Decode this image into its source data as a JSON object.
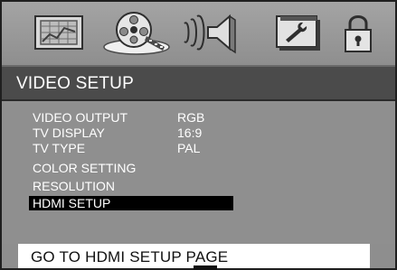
{
  "toolbar": {
    "icons": [
      {
        "name": "general-setup-icon"
      },
      {
        "name": "video-setup-icon",
        "selected": true
      },
      {
        "name": "audio-setup-icon"
      },
      {
        "name": "preferences-setup-icon"
      },
      {
        "name": "password-lock-icon"
      }
    ]
  },
  "header": {
    "title": "VIDEO SETUP"
  },
  "menu": {
    "items": [
      {
        "label": "VIDEO OUTPUT",
        "value": "RGB"
      },
      {
        "label": "TV DISPLAY",
        "value": "16:9"
      },
      {
        "label": "TV TYPE",
        "value": "PAL"
      },
      {
        "label": "COLOR SETTING",
        "value": ""
      },
      {
        "label": "RESOLUTION",
        "value": ""
      },
      {
        "label": "HDMI SETUP",
        "value": "",
        "selected": true
      }
    ]
  },
  "footer": {
    "hint": "GO TO HDMI SETUP PAGE"
  },
  "colors": {
    "panel": "#8e8e8e",
    "header": "#4b4b4b",
    "selection": "#000000",
    "text": "#ffffff"
  }
}
